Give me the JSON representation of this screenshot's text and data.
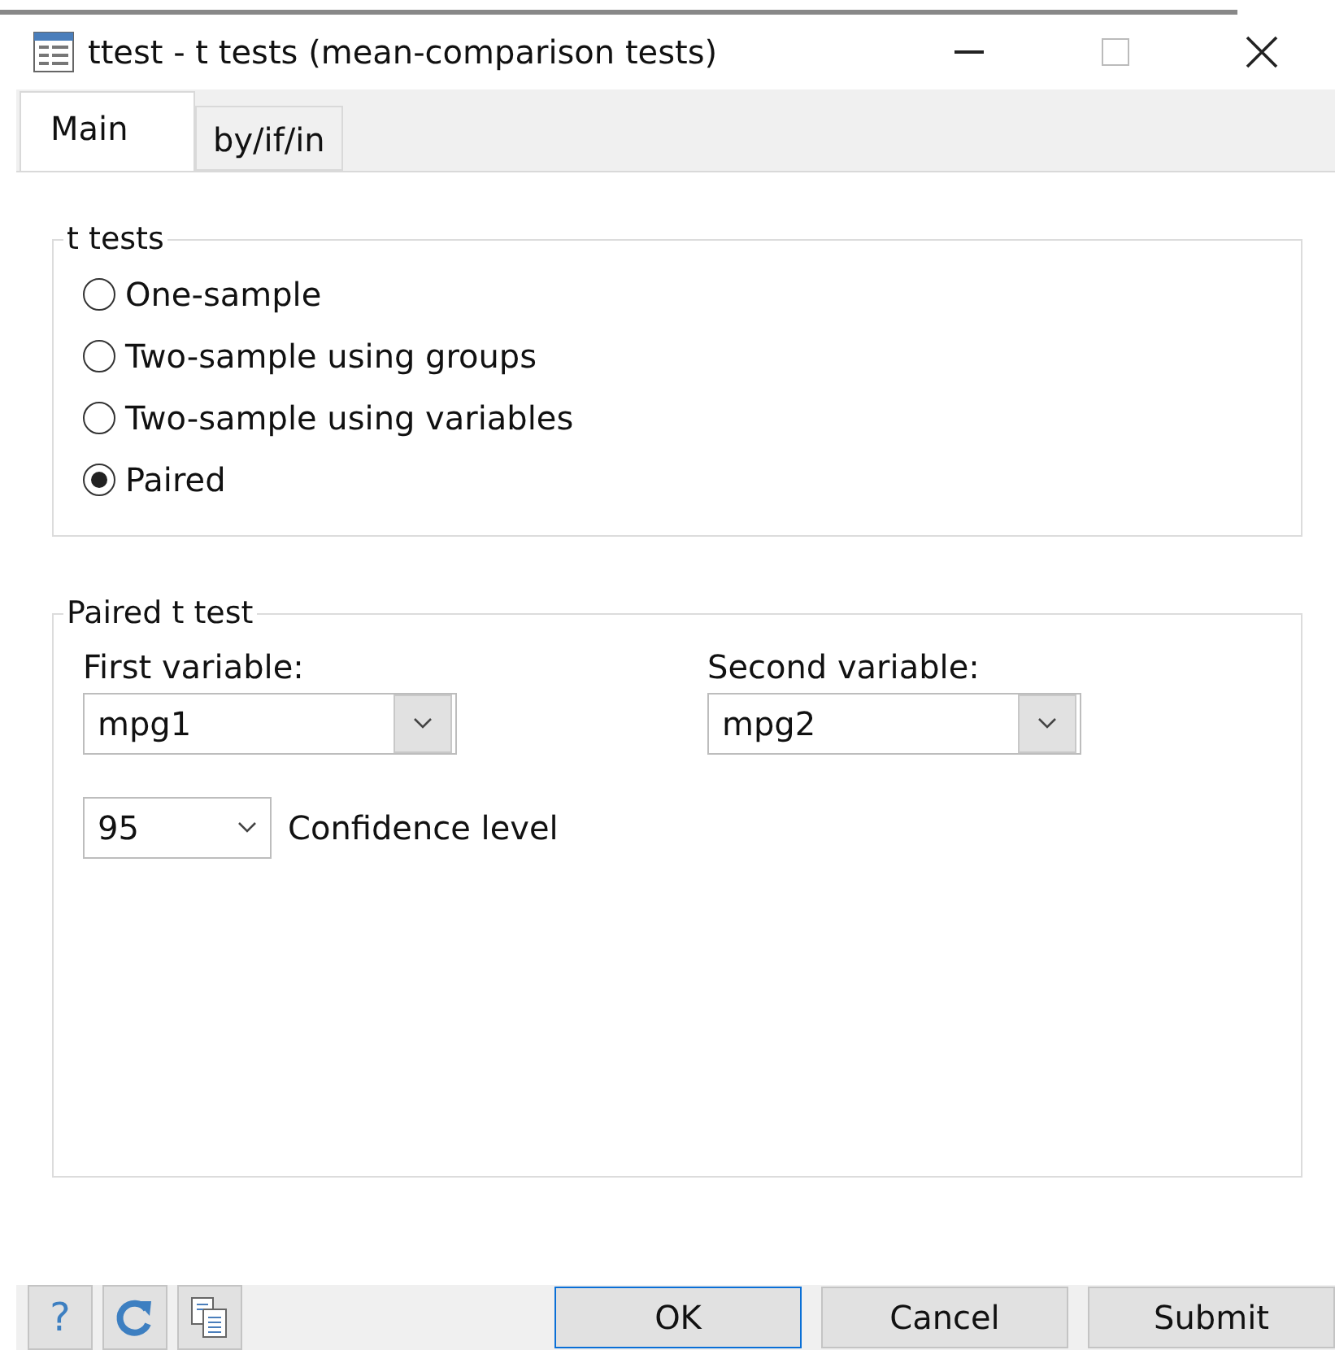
{
  "window": {
    "title": "ttest - t tests (mean-comparison tests)"
  },
  "tabs": [
    {
      "label": "Main",
      "selected": true
    },
    {
      "label": "by/if/in",
      "selected": false
    }
  ],
  "test_group": {
    "title": "t tests",
    "options": [
      {
        "label": "One-sample",
        "selected": false
      },
      {
        "label": "Two-sample using groups",
        "selected": false
      },
      {
        "label": "Two-sample using variables",
        "selected": false
      },
      {
        "label": "Paired",
        "selected": true
      }
    ]
  },
  "paired_group": {
    "title": "Paired t test",
    "fields": [
      {
        "label": "First variable:",
        "value": "mpg1"
      },
      {
        "label": "Second variable:",
        "value": "mpg2"
      }
    ],
    "confidence": {
      "value": "95",
      "label": "Confidence level"
    }
  },
  "footer": {
    "tools": [
      {
        "kind": "help",
        "label": "?"
      },
      {
        "kind": "reset"
      },
      {
        "kind": "copy"
      }
    ],
    "buttons": [
      {
        "label": "OK",
        "default": true
      },
      {
        "label": "Cancel",
        "default": false
      },
      {
        "label": "Submit",
        "default": false
      }
    ]
  }
}
